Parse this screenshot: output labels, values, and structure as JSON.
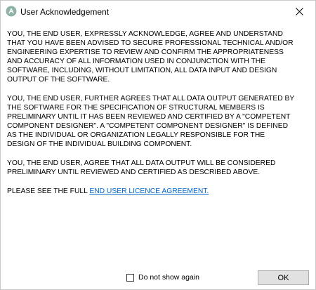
{
  "window": {
    "title": "User Acknowledgement",
    "icon": "app-logo-icon",
    "close_icon": "close-icon"
  },
  "paragraphs": [
    {
      "lines": [
        "YOU, THE END USER, EXPRESSLY ACKNOWLEDGE, AGREE AND UNDERSTAND",
        "THAT YOU HAVE BEEN ADVISED TO SECURE PROFESSIONAL TECHNICAL AND/OR",
        "ENGINEERING EXPERTISE TO REVIEW AND CONFIRM THE APPROPRIATENESS",
        "AND ACCURACY OF ALL INFORMATION USED IN CONJUNCTION WITH THE",
        "SOFTWARE, INCLUDING, WITHOUT LIMITATION, ALL DATA INPUT AND DESIGN",
        "OUTPUT OF THE SOFTWARE."
      ]
    },
    {
      "lines": [
        "YOU, THE END USER, FURTHER AGREES THAT ALL DATA OUTPUT GENERATED BY",
        "THE SOFTWARE FOR THE SPECIFICATION OF STRUCTURAL MEMBERS IS",
        "PRELIMINARY UNTIL IT HAS BEEN REVIEWED AND CERTIFIED BY A \"COMPETENT",
        "COMPONENT DESIGNER\".  A \"COMPETENT COMPONENT DESIGNER\" IS DEFINED",
        "AS THE INDIVIDUAL OR ORGANIZATION LEGALLY RESPONSIBLE FOR THE",
        "DESIGN OF THE INDIVIDUAL BUILDING COMPONENT."
      ]
    },
    {
      "lines": [
        "YOU, THE END USER, AGREE THAT ALL DATA OUTPUT WILL BE CONSIDERED",
        "PRELIMINARY UNTIL REVIEWED AND CERTIFIED AS DESCRIBED ABOVE."
      ]
    }
  ],
  "licence": {
    "prefix": "PLEASE SEE THE FULL ",
    "link_text": "END USER LICENCE AGREEMENT."
  },
  "footer": {
    "checkbox_label": "Do not show again",
    "checkbox_checked": false,
    "ok_label": "OK"
  },
  "colors": {
    "link": "#0066cc",
    "icon_bg": "#8fb3a5",
    "button_bg": "#e1e1e1"
  }
}
